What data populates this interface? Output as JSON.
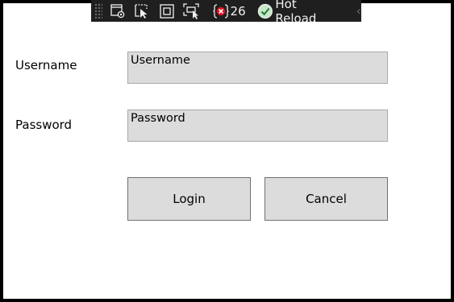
{
  "toolbar": {
    "icons": [
      "live-visual-tree-icon",
      "select-element-icon",
      "display-layout-adorners-icon",
      "track-focused-element-icon"
    ],
    "error_count": "26",
    "hot_reload_label": "Hot Reload",
    "hot_reload_status_color": "#c8e6c9"
  },
  "form": {
    "username_label": "Username",
    "username_value": "Username",
    "password_label": "Password",
    "password_value": "Password",
    "login_label": "Login",
    "cancel_label": "Cancel"
  },
  "colors": {
    "field_bg": "#dcdcdc",
    "toolbar_bg": "#1f1f1f"
  }
}
